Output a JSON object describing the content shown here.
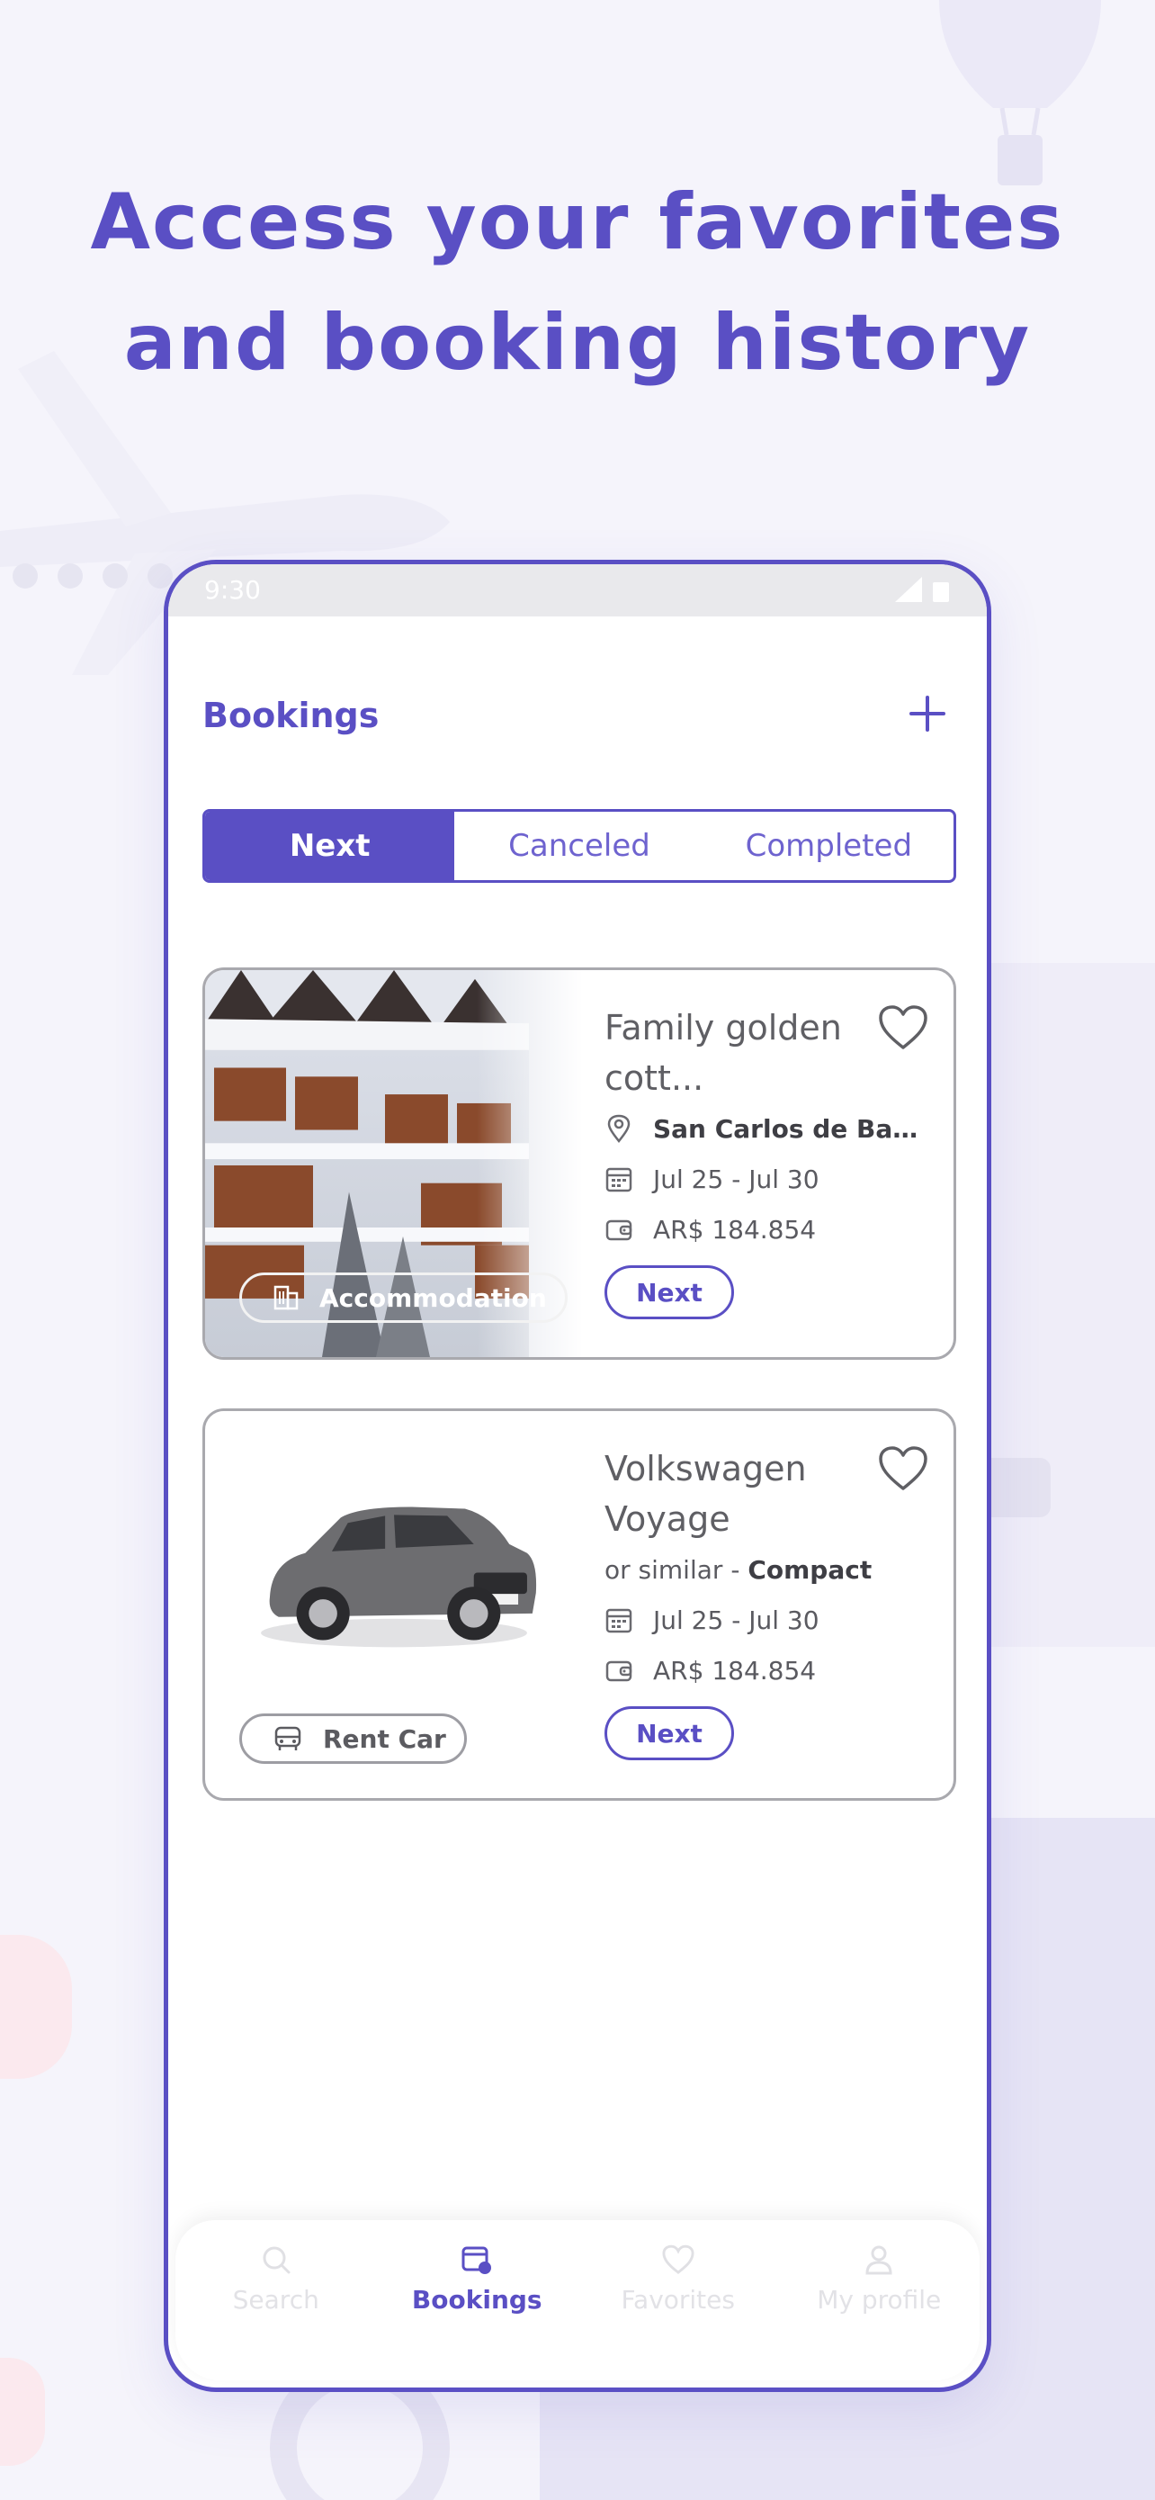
{
  "headline": {
    "line1": "Access your favorites",
    "line2": "and booking history"
  },
  "status_bar": {
    "time": "9:30"
  },
  "bookings": {
    "title": "Bookings",
    "add_icon": "plus-icon"
  },
  "tabs": [
    {
      "label": "Next",
      "active": true
    },
    {
      "label": "Canceled",
      "active": false
    },
    {
      "label": "Completed",
      "active": false
    }
  ],
  "cards": [
    {
      "title": "Family golden cott...",
      "location": "San Carlos de Baril...",
      "dates": "Jul 25 - Jul 30",
      "price": "AR$ 184.854",
      "status_button": "Next",
      "tag": "Accommodation",
      "tag_icon": "building-icon"
    },
    {
      "title": "Volkswagen Voyage",
      "similar_prefix": "or similar - ",
      "similar_class": "Compact",
      "dates": "Jul 25 - Jul 30",
      "price": "AR$ 184.854",
      "status_button": "Next",
      "tag": "Rent Car",
      "tag_icon": "car-icon"
    }
  ],
  "bottom_nav": [
    {
      "label": "Search",
      "icon": "search-icon",
      "active": false
    },
    {
      "label": "Bookings",
      "icon": "calendar-icon",
      "active": true
    },
    {
      "label": "Favorites",
      "icon": "heart-icon",
      "active": false
    },
    {
      "label": "My profile",
      "icon": "user-icon",
      "active": false
    }
  ],
  "colors": {
    "accent": "#5a4fc4",
    "background": "#f5f4fb",
    "text": "#5f5f64",
    "border": "#a9a9ae"
  }
}
